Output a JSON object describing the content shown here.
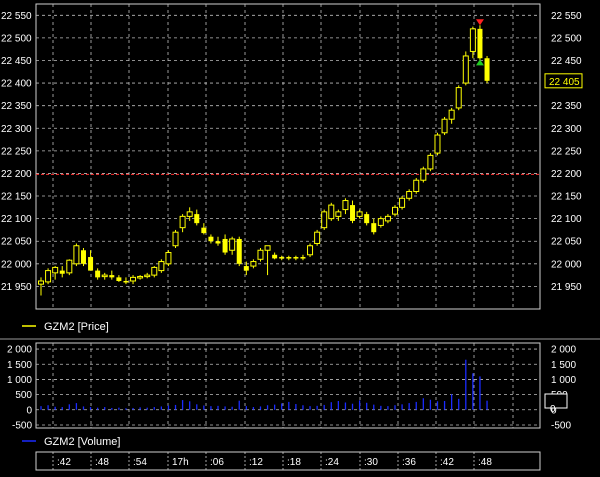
{
  "chart_data": [
    {
      "type": "candlestick",
      "series_name": "GZM2 [Price]",
      "legend_color": "#ffff00",
      "up_color": "#ffff00",
      "down_color": "#ffff00",
      "y_ticks": [
        "22 550",
        "22 500",
        "22 450",
        "22 400",
        "22 350",
        "22 300",
        "22 250",
        "22 200",
        "22 150",
        "22 100",
        "22 050",
        "22 000",
        "21 950"
      ],
      "y_tick_values": [
        22550,
        22500,
        22450,
        22400,
        22350,
        22300,
        22250,
        22200,
        22150,
        22100,
        22050,
        22000,
        21950
      ],
      "ylim": [
        21900,
        22575
      ],
      "last_price_label": "22 405",
      "last_price": 22405,
      "reference_line": {
        "value": 22198,
        "color": "#ff3333"
      },
      "markers": [
        {
          "type": "high-marker",
          "x": ":43",
          "y": 22528,
          "color": "#ff2222"
        },
        {
          "type": "low-marker",
          "x": ":43",
          "y": 22448,
          "color": "#22cc22"
        }
      ],
      "candles": [
        {
          "t": 0,
          "o": 21955,
          "h": 21970,
          "l": 21930,
          "c": 21962
        },
        {
          "t": 1,
          "o": 21960,
          "h": 21990,
          "l": 21955,
          "c": 21985
        },
        {
          "t": 2,
          "o": 21980,
          "h": 21995,
          "l": 21965,
          "c": 21992
        },
        {
          "t": 3,
          "o": 21985,
          "h": 21995,
          "l": 21970,
          "c": 21978
        },
        {
          "t": 4,
          "o": 21980,
          "h": 22010,
          "l": 21975,
          "c": 22008
        },
        {
          "t": 5,
          "o": 22000,
          "h": 22045,
          "l": 21995,
          "c": 22040
        },
        {
          "t": 6,
          "o": 22030,
          "h": 22035,
          "l": 21995,
          "c": 22000
        },
        {
          "t": 7,
          "o": 22015,
          "h": 22030,
          "l": 21985,
          "c": 21985
        },
        {
          "t": 8,
          "o": 21985,
          "h": 21990,
          "l": 21965,
          "c": 21970
        },
        {
          "t": 9,
          "o": 21972,
          "h": 21980,
          "l": 21965,
          "c": 21975
        },
        {
          "t": 10,
          "o": 21975,
          "h": 21985,
          "l": 21965,
          "c": 21970
        },
        {
          "t": 11,
          "o": 21970,
          "h": 21975,
          "l": 21960,
          "c": 21962
        },
        {
          "t": 12,
          "o": 21962,
          "h": 21970,
          "l": 21955,
          "c": 21960
        },
        {
          "t": 13,
          "o": 21962,
          "h": 21975,
          "l": 21955,
          "c": 21970
        },
        {
          "t": 14,
          "o": 21970,
          "h": 21975,
          "l": 21965,
          "c": 21972
        },
        {
          "t": 15,
          "o": 21972,
          "h": 21980,
          "l": 21968,
          "c": 21975
        },
        {
          "t": 16,
          "o": 21975,
          "h": 21995,
          "l": 21970,
          "c": 21992
        },
        {
          "t": 17,
          "o": 21985,
          "h": 22010,
          "l": 21980,
          "c": 22005
        },
        {
          "t": 18,
          "o": 22000,
          "h": 22030,
          "l": 21995,
          "c": 22025
        },
        {
          "t": 19,
          "o": 22040,
          "h": 22075,
          "l": 22035,
          "c": 22070
        },
        {
          "t": 20,
          "o": 22080,
          "h": 22110,
          "l": 22070,
          "c": 22105
        },
        {
          "t": 21,
          "o": 22105,
          "h": 22125,
          "l": 22095,
          "c": 22115
        },
        {
          "t": 22,
          "o": 22110,
          "h": 22120,
          "l": 22085,
          "c": 22090
        },
        {
          "t": 23,
          "o": 22080,
          "h": 22090,
          "l": 22065,
          "c": 22068
        },
        {
          "t": 24,
          "o": 22060,
          "h": 22065,
          "l": 22045,
          "c": 22050
        },
        {
          "t": 25,
          "o": 22050,
          "h": 22060,
          "l": 22040,
          "c": 22045
        },
        {
          "t": 26,
          "o": 22055,
          "h": 22065,
          "l": 22020,
          "c": 22025
        },
        {
          "t": 27,
          "o": 22030,
          "h": 22060,
          "l": 22020,
          "c": 22055
        },
        {
          "t": 28,
          "o": 22055,
          "h": 22060,
          "l": 21995,
          "c": 22000
        },
        {
          "t": 29,
          "o": 21995,
          "h": 22005,
          "l": 21975,
          "c": 21985
        },
        {
          "t": 30,
          "o": 21995,
          "h": 22010,
          "l": 21990,
          "c": 22005
        },
        {
          "t": 31,
          "o": 22010,
          "h": 22035,
          "l": 22005,
          "c": 22030
        },
        {
          "t": 32,
          "o": 22030,
          "h": 22040,
          "l": 21975,
          "c": 22040
        },
        {
          "t": 33,
          "o": 22020,
          "h": 22025,
          "l": 22010,
          "c": 22012
        },
        {
          "t": 34,
          "o": 22015,
          "h": 22018,
          "l": 22008,
          "c": 22012
        },
        {
          "t": 35,
          "o": 22015,
          "h": 22018,
          "l": 22008,
          "c": 22012
        },
        {
          "t": 36,
          "o": 22015,
          "h": 22018,
          "l": 22008,
          "c": 22012
        },
        {
          "t": 37,
          "o": 22015,
          "h": 22020,
          "l": 22008,
          "c": 22012
        },
        {
          "t": 38,
          "o": 22020,
          "h": 22045,
          "l": 22015,
          "c": 22040
        },
        {
          "t": 39,
          "o": 22045,
          "h": 22075,
          "l": 22040,
          "c": 22070
        },
        {
          "t": 40,
          "o": 22080,
          "h": 22120,
          "l": 22075,
          "c": 22115
        },
        {
          "t": 41,
          "o": 22100,
          "h": 22135,
          "l": 22095,
          "c": 22130
        },
        {
          "t": 42,
          "o": 22105,
          "h": 22120,
          "l": 22095,
          "c": 22115
        },
        {
          "t": 43,
          "o": 22120,
          "h": 22145,
          "l": 22110,
          "c": 22140
        },
        {
          "t": 44,
          "o": 22130,
          "h": 22140,
          "l": 22090,
          "c": 22095
        },
        {
          "t": 45,
          "o": 22105,
          "h": 22120,
          "l": 22100,
          "c": 22115
        },
        {
          "t": 46,
          "o": 22110,
          "h": 22115,
          "l": 22085,
          "c": 22090
        },
        {
          "t": 47,
          "o": 22090,
          "h": 22100,
          "l": 22065,
          "c": 22070
        },
        {
          "t": 48,
          "o": 22085,
          "h": 22105,
          "l": 22080,
          "c": 22100
        },
        {
          "t": 49,
          "o": 22095,
          "h": 22110,
          "l": 22090,
          "c": 22105
        },
        {
          "t": 50,
          "o": 22110,
          "h": 22130,
          "l": 22105,
          "c": 22125
        },
        {
          "t": 51,
          "o": 22125,
          "h": 22150,
          "l": 22120,
          "c": 22145
        },
        {
          "t": 52,
          "o": 22145,
          "h": 22165,
          "l": 22140,
          "c": 22160
        },
        {
          "t": 53,
          "o": 22160,
          "h": 22190,
          "l": 22155,
          "c": 22185
        },
        {
          "t": 54,
          "o": 22185,
          "h": 22215,
          "l": 22180,
          "c": 22210
        },
        {
          "t": 55,
          "o": 22210,
          "h": 22245,
          "l": 22205,
          "c": 22240
        },
        {
          "t": 56,
          "o": 22245,
          "h": 22290,
          "l": 22240,
          "c": 22285
        },
        {
          "t": 57,
          "o": 22290,
          "h": 22325,
          "l": 22285,
          "c": 22320
        },
        {
          "t": 58,
          "o": 22320,
          "h": 22345,
          "l": 22310,
          "c": 22340
        },
        {
          "t": 59,
          "o": 22345,
          "h": 22395,
          "l": 22340,
          "c": 22390
        },
        {
          "t": 60,
          "o": 22400,
          "h": 22470,
          "l": 22395,
          "c": 22460
        },
        {
          "t": 61,
          "o": 22470,
          "h": 22525,
          "l": 22455,
          "c": 22520
        },
        {
          "t": 62,
          "o": 22520,
          "h": 22528,
          "l": 22448,
          "c": 22455
        },
        {
          "t": 63,
          "o": 22455,
          "h": 22460,
          "l": 22400,
          "c": 22405
        }
      ]
    },
    {
      "type": "bar",
      "series_name": "GZM2 [Volume]",
      "legend_color": "#1a2bff",
      "bar_color": "#1a2bff",
      "y_ticks": [
        "2 000",
        "1 500",
        "1 000",
        "500",
        "0",
        "-500"
      ],
      "y_tick_values": [
        2000,
        1500,
        1000,
        500,
        0,
        -500
      ],
      "ylim": [
        -600,
        2200
      ],
      "last_value_label": "0",
      "values": [
        120,
        150,
        100,
        90,
        180,
        220,
        110,
        90,
        70,
        90,
        60,
        70,
        50,
        60,
        80,
        70,
        90,
        110,
        140,
        160,
        320,
        280,
        180,
        140,
        120,
        130,
        110,
        100,
        300,
        120,
        90,
        110,
        150,
        170,
        210,
        260,
        190,
        150,
        120,
        130,
        160,
        250,
        290,
        240,
        200,
        310,
        230,
        170,
        130,
        120,
        150,
        180,
        220,
        260,
        380,
        330,
        280,
        290,
        510,
        360,
        1650,
        1200,
        1100,
        300
      ]
    }
  ],
  "time_axis": {
    "ticks": [
      ":42",
      ":48",
      ":54",
      "17h",
      ":06",
      ":12",
      ":18",
      ":24",
      ":30",
      ":36",
      ":42",
      ":48"
    ]
  }
}
